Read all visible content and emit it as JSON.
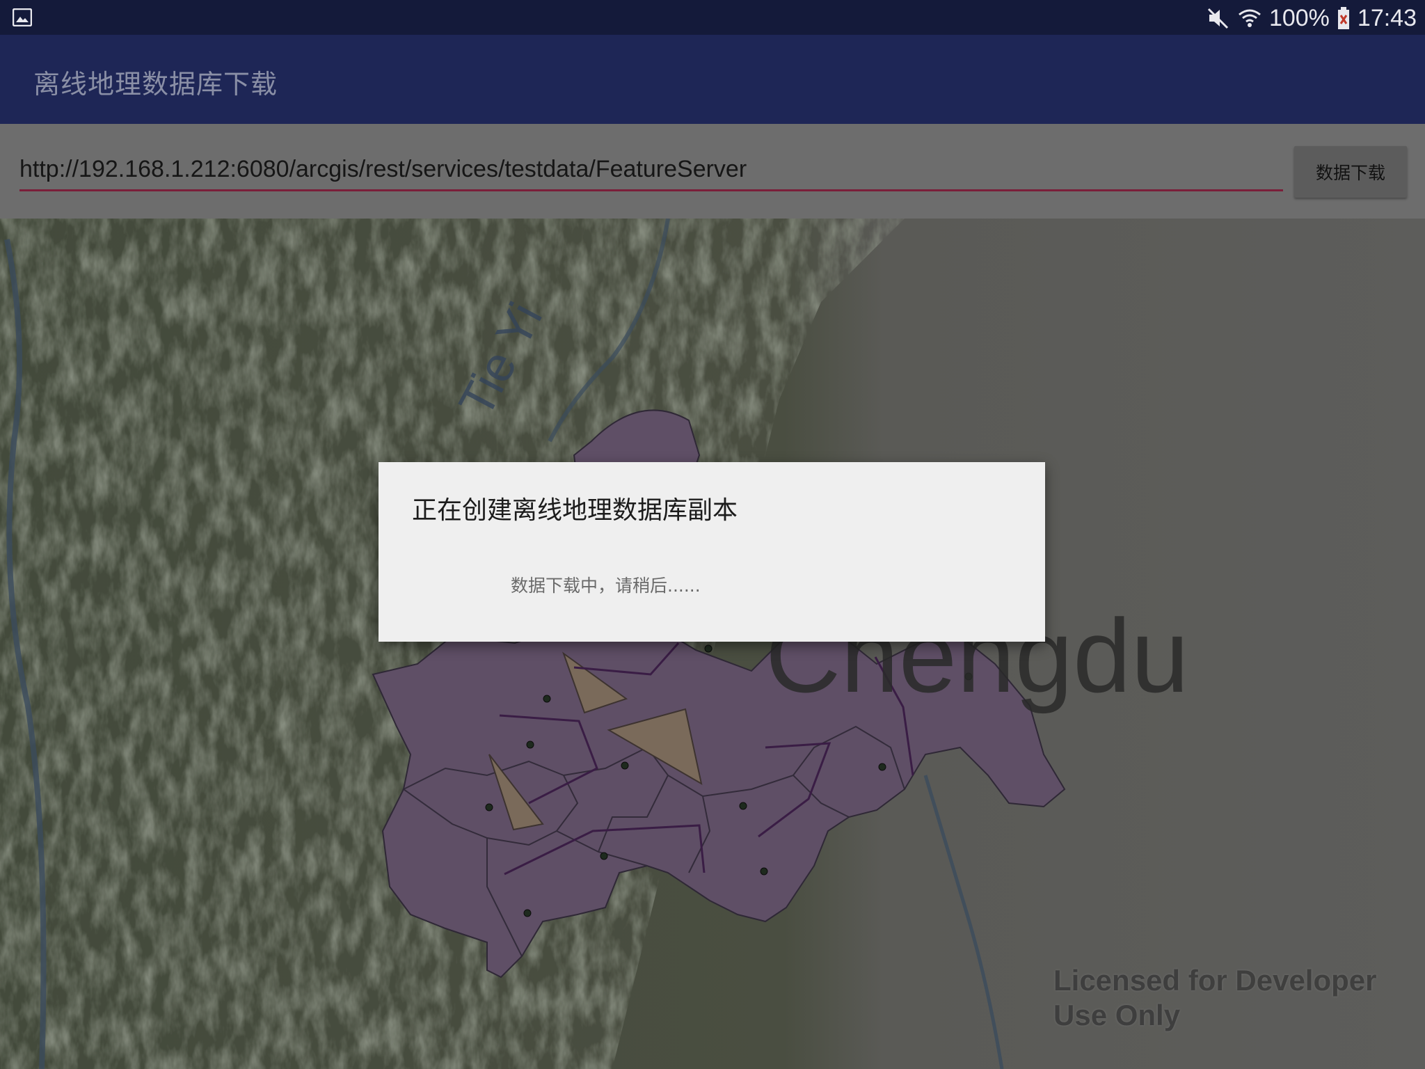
{
  "status_bar": {
    "battery": "100%",
    "time": "17:43",
    "icons": [
      "gallery-icon",
      "mute-icon",
      "wifi-icon",
      "battery-icon"
    ]
  },
  "app_bar": {
    "title": "离线地理数据库下载"
  },
  "url_row": {
    "url_value": "http://192.168.1.212:6080/arcgis/rest/services/testdata/FeatureServer",
    "download_label": "数据下载"
  },
  "map": {
    "city_label": "Chengdu",
    "watermark": "Licensed for Developer Use Only"
  },
  "dialog": {
    "title": "正在创建离线地理数据库副本",
    "message": "数据下载中，请稍后......"
  },
  "colors": {
    "status_bar": "#141a3a",
    "app_bar": "#1e2656",
    "accent_underline": "#7a1f3a",
    "polygon_fill": "#5f4f66",
    "dialog_bg": "#efefef"
  }
}
